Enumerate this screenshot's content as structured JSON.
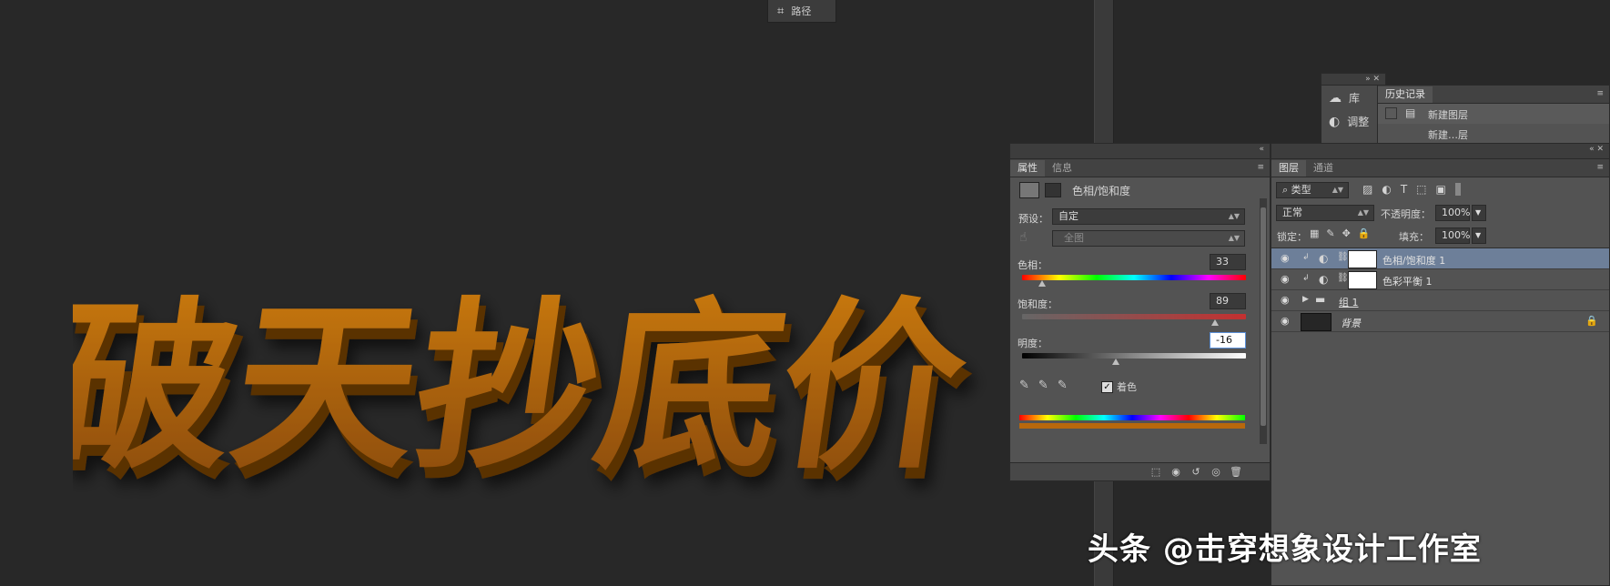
{
  "paths_tab": {
    "label": "路径"
  },
  "artwork": {
    "text": "破天抄底价",
    "color": "#b8680c"
  },
  "mini_panel": {
    "items": [
      {
        "label": "库"
      },
      {
        "label": "调整"
      }
    ]
  },
  "history_panel": {
    "tab": "历史记录",
    "items": [
      {
        "label": "新建图层"
      },
      {
        "label": "新建…层"
      }
    ]
  },
  "properties_panel": {
    "tabs": [
      {
        "label": "属性",
        "active": true
      },
      {
        "label": "信息",
        "active": false
      }
    ],
    "title": "色相/饱和度",
    "preset_label": "预设：",
    "preset_value": "自定",
    "channel_value": "全图",
    "hue": {
      "label": "色相：",
      "value": "33",
      "fraction": 0.09
    },
    "saturation": {
      "label": "饱和度：",
      "value": "89",
      "fraction": 0.86
    },
    "lightness": {
      "label": "明度：",
      "value": "-16",
      "fraction": 0.42
    },
    "colorize_label": "着色",
    "colorize_checked": true,
    "result_color": "#b8680c"
  },
  "layers_panel": {
    "tabs": [
      {
        "label": "图层",
        "active": true
      },
      {
        "label": "通道",
        "active": false
      }
    ],
    "filter_value": "类型",
    "blend_mode": "正常",
    "opacity_label": "不透明度：",
    "opacity_value": "100%",
    "lock_label": "锁定：",
    "fill_label": "填充：",
    "fill_value": "100%",
    "layers": [
      {
        "name": "色相/饱和度 1",
        "selected": true
      },
      {
        "name": "色彩平衡 1",
        "selected": false
      },
      {
        "name": "组 1",
        "selected": false
      },
      {
        "name": "背景",
        "selected": false
      }
    ]
  },
  "watermark": {
    "text": "头条 @击穿想象设计工作室"
  }
}
